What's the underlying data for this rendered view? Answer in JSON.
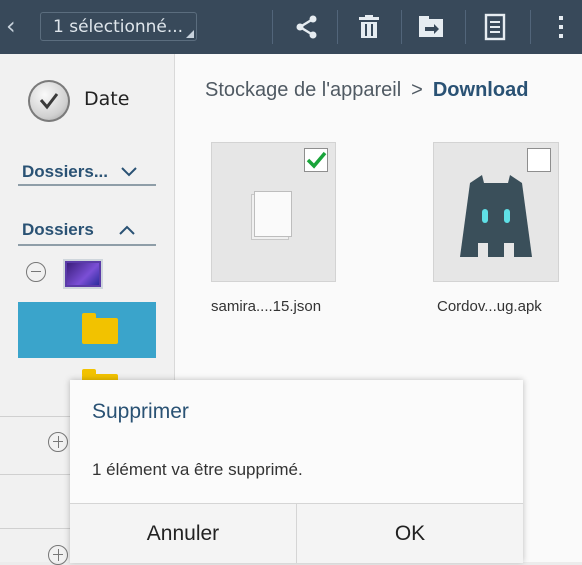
{
  "topbar": {
    "selection_label": "1 sélectionné...",
    "icons": [
      "back-icon",
      "share-icon",
      "trash-icon",
      "move-icon",
      "details-icon",
      "more-icon"
    ]
  },
  "sidebar": {
    "date_label": "Date",
    "section1_label": "Dossiers...",
    "section2_label": "Dossiers"
  },
  "breadcrumb": {
    "root": "Stockage de l'appareil",
    "separator": ">",
    "current": "Download"
  },
  "files": [
    {
      "name": "samira....15.json",
      "checked": true,
      "icon": "document-icon"
    },
    {
      "name": "Cordov...ug.apk",
      "checked": false,
      "icon": "cordova-app-icon"
    }
  ],
  "dialog": {
    "title": "Supprimer",
    "message": "1 élément va être supprimé.",
    "cancel_label": "Annuler",
    "ok_label": "OK"
  },
  "colors": {
    "topbar_bg": "#38495a",
    "accent": "#2a5274",
    "selection": "#3aa4cb",
    "folder": "#f2c200",
    "check": "#19a43a"
  }
}
